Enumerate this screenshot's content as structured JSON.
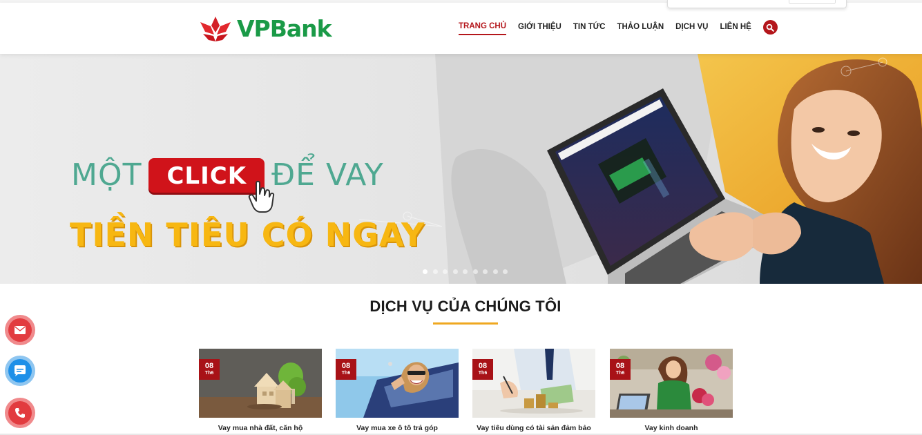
{
  "header": {
    "logo_text": "VPBank",
    "nav": [
      {
        "label": "TRANG CHỦ",
        "active": true
      },
      {
        "label": "GIỚI THIỆU",
        "active": false
      },
      {
        "label": "TIN TỨC",
        "active": false
      },
      {
        "label": "THẢO LUẬN",
        "active": false
      },
      {
        "label": "DỊCH VỤ",
        "active": false
      },
      {
        "label": "LIÊN HỆ",
        "active": false
      }
    ],
    "search_icon": "search-icon"
  },
  "banner": {
    "word_1": "MỘT",
    "click_label": "CLICK",
    "word_2": "ĐỂ VAY",
    "line_2": "TIỀN TIÊU CÓ NGAY",
    "slide_count": 9,
    "active_slide": 1
  },
  "section": {
    "title": "DỊCH VỤ CỦA CHÚNG TÔI"
  },
  "cards": [
    {
      "day": "08",
      "month": "Th6",
      "caption": "Vay mua nhà đất, căn hộ"
    },
    {
      "day": "08",
      "month": "Th6",
      "caption": "Vay mua xe ô tô trả góp"
    },
    {
      "day": "08",
      "month": "Th6",
      "caption": "Vay tiêu dùng có tài sản đảm bảo"
    },
    {
      "day": "08",
      "month": "Th6",
      "caption": "Vay kinh doanh"
    }
  ],
  "floating_buttons": [
    {
      "icon": "envelope-icon"
    },
    {
      "icon": "zalo-chat-icon"
    },
    {
      "icon": "phone-icon"
    }
  ],
  "colors": {
    "brand_red": "#b4161b",
    "brand_green": "#1a9a47",
    "accent_yellow": "#efa820"
  }
}
